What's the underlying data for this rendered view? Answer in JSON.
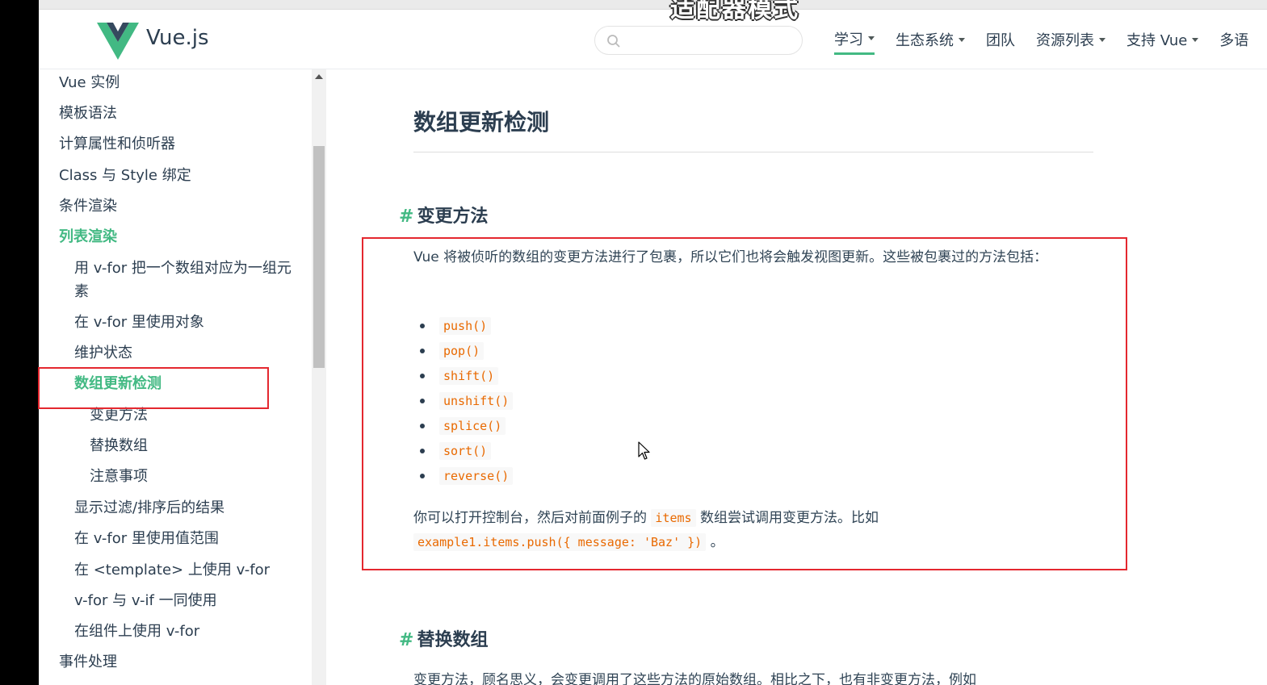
{
  "overlay_title": "适配器模式",
  "header": {
    "brand": "Vue.js",
    "search_placeholder": "",
    "nav": [
      {
        "label": "学习",
        "dropdown": true,
        "active": true
      },
      {
        "label": "生态系统",
        "dropdown": true
      },
      {
        "label": "团队",
        "dropdown": false
      },
      {
        "label": "资源列表",
        "dropdown": true
      },
      {
        "label": "支持 Vue",
        "dropdown": true
      },
      {
        "label": "多语",
        "dropdown": false
      }
    ]
  },
  "sidebar": {
    "items": [
      {
        "label": "Vue 实例",
        "level": 0
      },
      {
        "label": "模板语法",
        "level": 0
      },
      {
        "label": "计算属性和侦听器",
        "level": 0
      },
      {
        "label": "Class 与 Style 绑定",
        "level": 0
      },
      {
        "label": "条件渲染",
        "level": 0
      },
      {
        "label": "列表渲染",
        "level": 0,
        "active": true
      },
      {
        "label": "用 v-for 把一个数组对应为一组元",
        "level": 1
      },
      {
        "label": "素",
        "level": 1
      },
      {
        "label": "在 v-for 里使用对象",
        "level": 1
      },
      {
        "label": "维护状态",
        "level": 1
      },
      {
        "label": "数组更新检测",
        "level": 1,
        "active": true
      },
      {
        "label": "变更方法",
        "level": 2
      },
      {
        "label": "替换数组",
        "level": 2
      },
      {
        "label": "注意事项",
        "level": 2
      },
      {
        "label": "显示过滤/排序后的结果",
        "level": 1
      },
      {
        "label": "在 v-for 里使用值范围",
        "level": 1
      },
      {
        "label": "在 <template> 上使用 v-for",
        "level": 1
      },
      {
        "label": "v-for 与 v-if 一同使用",
        "level": 1
      },
      {
        "label": "在组件上使用 v-for",
        "level": 1
      },
      {
        "label": "事件处理",
        "level": 0
      }
    ]
  },
  "content": {
    "title": "数组更新检测",
    "section1": {
      "hash": "#",
      "heading": "变更方法",
      "intro": "Vue 将被侦听的数组的变更方法进行了包裹，所以它们也将会触发视图更新。这些被包裹过的方法包括：",
      "methods": [
        "push()",
        "pop()",
        "shift()",
        "unshift()",
        "splice()",
        "sort()",
        "reverse()"
      ],
      "outro_before": "你可以打开控制台，然后对前面例子的",
      "outro_code1": "items",
      "outro_middle": "数组尝试调用变更方法。比如",
      "outro_code2": "example1.items.push({ message: 'Baz' })",
      "outro_end": "。"
    },
    "section2": {
      "hash": "#",
      "heading": "替换数组",
      "intro": "变更方法，顾名思义，会变更调用了这些方法的原始数组。相比之下，也有非变更方法，例如"
    }
  },
  "colors": {
    "accent": "#42b983",
    "text": "#2c3e50",
    "code": "#e96900",
    "highlight_box": "#e4282f"
  }
}
